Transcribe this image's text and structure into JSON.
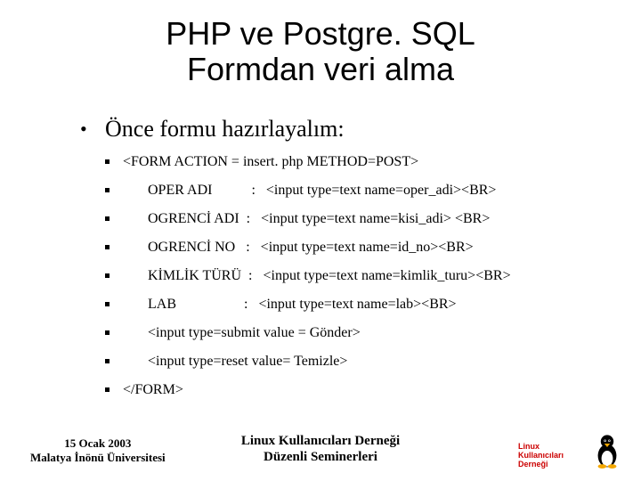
{
  "title_line1": "PHP ve Postgre. SQL",
  "title_line2": "Formdan veri alma",
  "heading": "Önce formu hazırlayalım:",
  "lines": [
    "<FORM ACTION = insert. php METHOD=POST>",
    "OPER ADI           :   <input type=text name=oper_adi><BR>",
    "OGRENCİ ADI  :   <input type=text name=kisi_adi> <BR>",
    "OGRENCİ NO   :   <input type=text name=id_no><BR>",
    "KİMLİK TÜRÜ  :   <input type=text name=kimlik_turu><BR>",
    "LAB                   :   <input type=text name=lab><BR>",
    "<input type=submit value = Gönder>",
    "<input type=reset value= Temizle>",
    "</FORM>"
  ],
  "footer_left_line1": "15 Ocak 2003",
  "footer_left_line2": "Malatya İnönü Üniversitesi",
  "footer_center_line1": "Linux Kullanıcıları Derneği",
  "footer_center_line2": "Düzenli Seminerleri",
  "logo_line1": "Linux Kullanıcıları",
  "logo_line2": "Derneği"
}
